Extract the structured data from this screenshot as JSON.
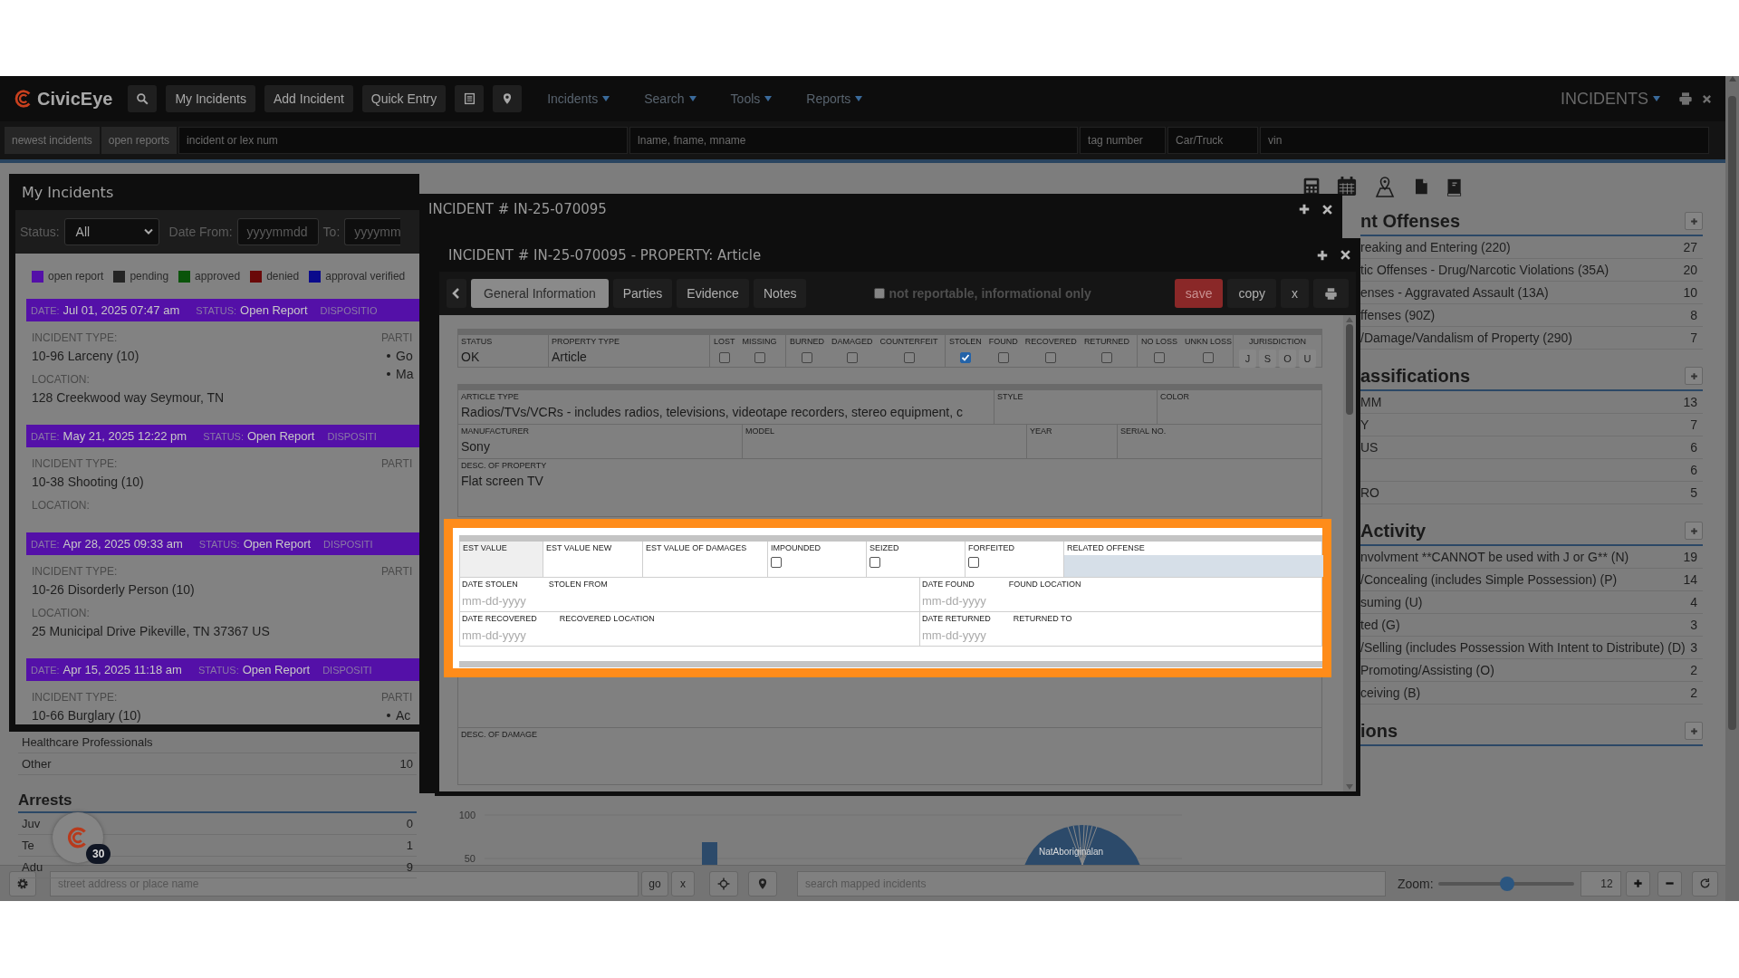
{
  "navbar": {
    "brand": "CivicEye",
    "buttons": [
      "My Incidents",
      "Add Incident",
      "Quick Entry"
    ],
    "menus": [
      "Incidents",
      "Search",
      "Tools",
      "Reports"
    ],
    "module": "INCIDENTS"
  },
  "quick_search": {
    "buttons": [
      "newest incidents",
      "open reports"
    ],
    "fields": [
      {
        "placeholder": "incident or lex num"
      },
      {
        "placeholder": "lname, fname, mname"
      },
      {
        "placeholder": "tag number"
      },
      {
        "placeholder": "Car/Truck"
      },
      {
        "placeholder": "vin"
      }
    ]
  },
  "right_panel": {
    "sections": [
      {
        "title": "nt Offenses",
        "rows": [
          {
            "label": "reaking and Entering (220)",
            "count": "27"
          },
          {
            "label": "tic Offenses - Drug/Narcotic Violations (35A)",
            "count": "20"
          },
          {
            "label": "enses - Aggravated Assault (13A)",
            "count": "10"
          },
          {
            "label": "ffenses (90Z)",
            "count": "8"
          },
          {
            "label": "/Damage/Vandalism of Property (290)",
            "count": "7"
          }
        ]
      },
      {
        "title": "assifications",
        "rows": [
          {
            "label": "MM",
            "count": "13"
          },
          {
            "label": "Y",
            "count": "7"
          },
          {
            "label": "US",
            "count": "6"
          },
          {
            "count": "6"
          },
          {
            "label": "RO",
            "count": "5"
          }
        ]
      },
      {
        "title": "Activity",
        "rows": [
          {
            "label": "nvolvment **CANNOT be used with J or G** (N)",
            "count": "19"
          },
          {
            "label": "/Concealing (includes Simple Possession) (P)",
            "count": "14"
          },
          {
            "label": "suming (U)",
            "count": "4"
          },
          {
            "label": "ted (G)",
            "count": "3"
          },
          {
            "label": "/Selling (includes Possession With Intent to Distribute) (D)",
            "count": "3"
          },
          {
            "label": "Promoting/Assisting (O)",
            "count": "2"
          },
          {
            "label": "ceiving (B)",
            "count": "2"
          }
        ]
      },
      {
        "title": "ions"
      }
    ]
  },
  "left_lists": {
    "rows": [
      {
        "label": "Healthcare Professionals"
      },
      {
        "label": "Other",
        "count": "10"
      }
    ],
    "arrests": {
      "title": "Arrests",
      "rows": [
        {
          "label": "Juv",
          "count": "0"
        },
        {
          "label": "Te",
          "count": "1"
        },
        {
          "label": "Adu",
          "count": "9"
        }
      ]
    }
  },
  "chart": {
    "ticks": [
      "100",
      "50"
    ],
    "slice_label": "NatAboriginalan"
  },
  "chat_badge": "30",
  "my_incidents": {
    "title": "My Incidents",
    "status_label": "Status:",
    "status_value": "All",
    "date_from_label": "Date From:",
    "date_from_placeholder": "yyyymmdd",
    "to_label": "To:",
    "to_placeholder": "yyyymm",
    "legend": [
      {
        "label": "open report",
        "color": "#5410a8"
      },
      {
        "label": "pending",
        "color": "#242424"
      },
      {
        "label": "approved",
        "color": "#0a540a"
      },
      {
        "label": "denied",
        "color": "#6a0808"
      },
      {
        "label": "approval verified",
        "color": "#0a0a8c"
      }
    ],
    "incidents": [
      {
        "date_label": "DATE:",
        "date": "Jul 01, 2025 07:47 am",
        "status_label": "STATUS:",
        "status": "Open Report",
        "disposition_label": "DISPOSITIO",
        "type_label": "INCIDENT TYPE:",
        "type": "10-96 Larceny (10)",
        "location_label": "LOCATION:",
        "location": "128 Creekwood way Seymour, TN",
        "parties_label": "PARTI",
        "parties": [
          "Go",
          "Ma"
        ]
      },
      {
        "date_label": "DATE:",
        "date": "May 21, 2025 12:22 pm",
        "status_label": "STATUS:",
        "status": "Open Report",
        "disposition_label": "DISPOSITI",
        "type_label": "INCIDENT TYPE:",
        "type": "10-38 Shooting (10)",
        "location_label": "LOCATION:",
        "parties_label": "PARTI"
      },
      {
        "date_label": "DATE:",
        "date": "Apr 28, 2025 09:33 am",
        "status_label": "STATUS:",
        "status": "Open Report",
        "disposition_label": "DISPOSITI",
        "type_label": "INCIDENT TYPE:",
        "type": "10-26 Disorderly Person (10)",
        "location_label": "LOCATION:",
        "location": "25 Municipal Drive Pikeville, TN 37367 US",
        "parties_label": "PARTI"
      },
      {
        "date_label": "DATE:",
        "date": "Apr 15, 2025 11:18 am",
        "status_label": "STATUS:",
        "status": "Open Report",
        "disposition_label": "DISPOSITI",
        "type_label": "INCIDENT TYPE:",
        "type": "10-66 Burglary (10)",
        "parties_label": "PARTI",
        "parties": [
          "Ac"
        ]
      }
    ]
  },
  "incident_window": {
    "title": "INCIDENT # IN-25-070095"
  },
  "property_window": {
    "title": "INCIDENT # IN-25-070095 - PROPERTY: Article",
    "tabs": [
      {
        "label": "General Information",
        "selected": true
      },
      {
        "label": "Parties",
        "selected": false
      },
      {
        "label": "Evidence",
        "selected": false
      },
      {
        "label": "Notes",
        "selected": false
      }
    ],
    "not_reportable": {
      "label": "not reportable, informational only",
      "checked": false
    },
    "actions": [
      {
        "label": "save",
        "kind": "primary"
      },
      {
        "label": "copy",
        "kind": "plain"
      },
      {
        "label": "x",
        "kind": "plain"
      }
    ],
    "form": {
      "status": {
        "label": "STATUS",
        "value": "OK"
      },
      "property_type": {
        "label": "PROPERTY TYPE",
        "value": "Article"
      },
      "flag_groups": [
        [
          {
            "label": "LOST",
            "checked": false
          },
          {
            "label": "MISSING",
            "checked": false
          }
        ],
        [
          {
            "label": "BURNED",
            "checked": false
          },
          {
            "label": "DAMAGED",
            "checked": false
          },
          {
            "label": "COUNTERFEIT",
            "checked": false
          }
        ],
        [
          {
            "label": "STOLEN",
            "checked": true
          },
          {
            "label": "FOUND",
            "checked": false
          },
          {
            "label": "RECOVERED",
            "checked": false
          },
          {
            "label": "RETURNED",
            "checked": false
          }
        ],
        [
          {
            "label": "NO LOSS",
            "checked": false
          },
          {
            "label": "UNKN LOSS",
            "checked": false
          }
        ]
      ],
      "jurisdiction": {
        "label": "JURISDICTION",
        "options": [
          "J",
          "S",
          "O",
          "U"
        ]
      },
      "article_row": [
        {
          "label": "ARTICLE TYPE",
          "value": "Radios/TVs/VCRs - includes radios, televisions, videotape recorders, stereo equipment, c"
        },
        {
          "label": "STYLE"
        },
        {
          "label": "COLOR"
        }
      ],
      "make_row": [
        {
          "label": "MANUFACTURER",
          "value": "Sony"
        },
        {
          "label": "MODEL"
        },
        {
          "label": "YEAR"
        },
        {
          "label": "SERIAL NO."
        }
      ],
      "description": {
        "label": "DESC. OF PROPERTY",
        "value": "Flat screen TV"
      },
      "value_row": [
        {
          "label": "EST VALUE",
          "kind": "text",
          "disabled": true
        },
        {
          "label": "EST VALUE NEW",
          "kind": "text",
          "disabled": false
        },
        {
          "label": "EST VALUE OF DAMAGES",
          "kind": "text",
          "disabled": false
        },
        {
          "label": "IMPOUNDED",
          "kind": "checkbox",
          "checked": false,
          "disabled": false
        },
        {
          "label": "SEIZED",
          "kind": "checkbox",
          "checked": false,
          "disabled": false
        },
        {
          "label": "FORFEITED",
          "kind": "checkbox",
          "checked": false,
          "disabled": false
        },
        {
          "label": "RELATED OFFENSE",
          "kind": "select",
          "disabled": false
        }
      ],
      "date_rows": [
        [
          {
            "date_label": "DATE STOLEN",
            "placeholder": "mm-dd-yyyy",
            "place_label": "STOLEN FROM"
          },
          {
            "date_label": "DATE FOUND",
            "placeholder": "mm-dd-yyyy",
            "place_label": "FOUND LOCATION"
          }
        ],
        [
          {
            "date_label": "DATE RECOVERED",
            "placeholder": "mm-dd-yyyy",
            "place_label": "RECOVERED LOCATION"
          },
          {
            "date_label": "DATE RETURNED",
            "placeholder": "mm-dd-yyyy",
            "place_label": "RETURNED TO"
          }
        ]
      ],
      "damage": {
        "label": "DESC. OF DAMAGE"
      }
    }
  },
  "bottom_bar": {
    "address_placeholder": "street address or place name",
    "go": "go",
    "clear": "x",
    "search_placeholder": "search mapped incidents",
    "zoom_label": "Zoom:",
    "zoom": {
      "level": 0.51
    },
    "zoom_value": "12"
  }
}
